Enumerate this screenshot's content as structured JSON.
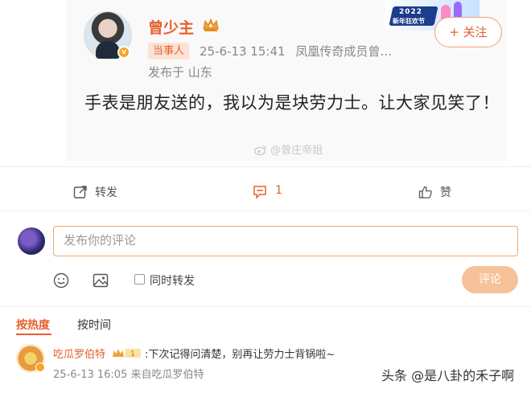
{
  "post": {
    "username": "曾少主",
    "tag": "当事人",
    "time": "25-6-13 15:41",
    "group": "凤凰传奇成员曾…",
    "location": "发布于 山东",
    "text": "手表是朋友送的，我以为是块劳力士。让大家见笑了！",
    "follow_label": "+ 关注",
    "banner_year": "2022",
    "banner_text": "新年狂欢节",
    "weibo_watermark": "@曾庄帝姐"
  },
  "actions": {
    "repost_label": "转发",
    "comment_count": "1",
    "like_label": "赞"
  },
  "composer": {
    "placeholder": "发布你的评论",
    "repost_checkbox_label": "同时转发",
    "submit_label": "评论"
  },
  "sort": {
    "hot_label": "按热度",
    "time_label": "按时间"
  },
  "comments": [
    {
      "username": "吃瓜罗伯特",
      "level": "1",
      "text": ":下次记得问清楚，别再让劳力士背锅啦~",
      "meta": "25-6-13 16:05 来自吃瓜罗伯特"
    }
  ],
  "watermark": "头条 @是八卦的禾子啊",
  "colors": {
    "accent": "#e6602d",
    "submit_disabled": "#f7c19a",
    "input_border": "#f0a96f"
  },
  "icons": {
    "repost": "repost-icon",
    "comment": "comment-icon",
    "like": "thumbs-up-icon",
    "emoji": "emoji-icon",
    "image": "image-icon",
    "crown": "crown-icon"
  }
}
